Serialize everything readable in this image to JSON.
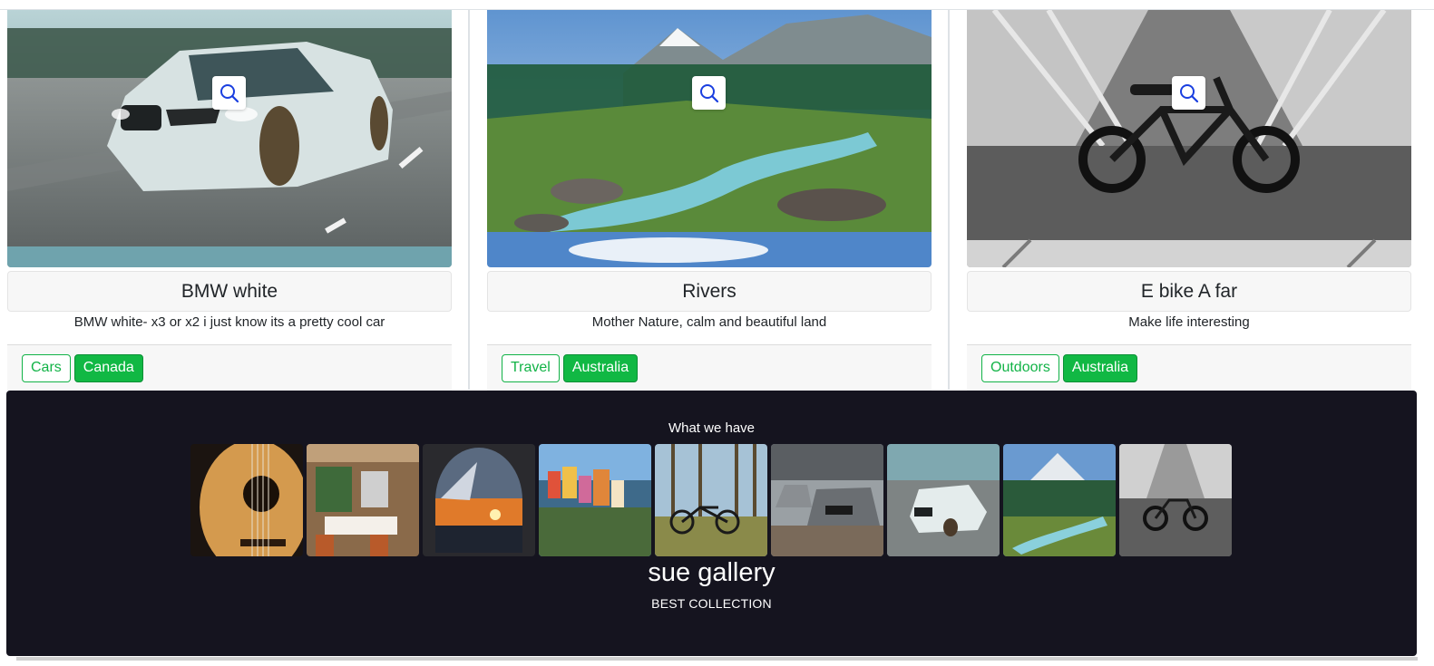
{
  "cards": [
    {
      "title": "BMW white",
      "description": "BMW white- x3 or x2 i just know its a pretty cool car",
      "image": "white-bmw-car-photo",
      "tags": [
        "Cars",
        "Canada"
      ]
    },
    {
      "title": "Rivers",
      "description": "Mother Nature, calm and beautiful land",
      "image": "mountain-river-photo",
      "tags": [
        "Travel",
        "Australia"
      ]
    },
    {
      "title": "E bike A far",
      "description": "Make life interesting",
      "image": "black-ebike-photo",
      "tags": [
        "Outdoors",
        "Australia"
      ]
    }
  ],
  "icons": {
    "zoom": "search-icon"
  },
  "footer": {
    "heading": "What we have",
    "thumbnails": [
      "guitar",
      "restaurant-patio",
      "airplane-window-sunset",
      "coastal-village",
      "bicycle-in-forest",
      "grey-bmw",
      "white-bmw",
      "mountain-river",
      "ebike"
    ],
    "brand": "sue gallery",
    "tagline": "BEST COLLECTION"
  },
  "colors": {
    "accent": "#11b844",
    "footer_bg": "#15141f",
    "card_header_bg": "#f7f7f7"
  }
}
